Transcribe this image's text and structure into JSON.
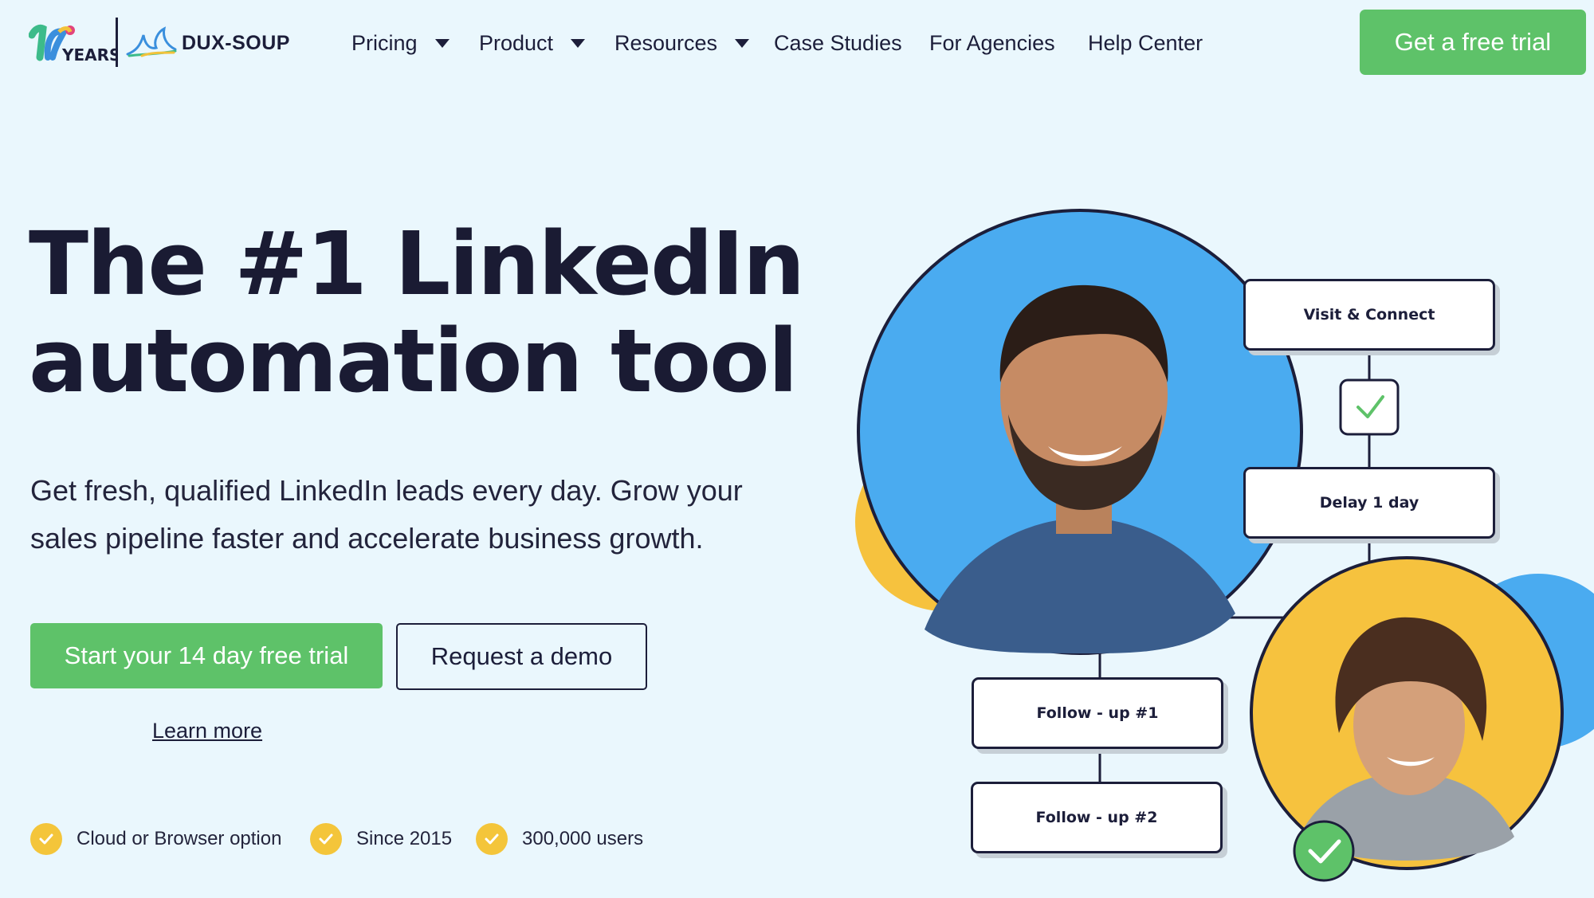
{
  "brand": {
    "anniversary_years_label": "YEARS",
    "name": "DUX-SOUP"
  },
  "nav": {
    "items": [
      {
        "label": "Pricing",
        "has_dropdown": true
      },
      {
        "label": "Product",
        "has_dropdown": true
      },
      {
        "label": "Resources",
        "has_dropdown": true
      },
      {
        "label": "Case Studies",
        "has_dropdown": false
      },
      {
        "label": "For Agencies",
        "has_dropdown": false
      },
      {
        "label": "Help Center",
        "has_dropdown": false
      }
    ],
    "cta_label": "Get a free trial"
  },
  "hero": {
    "headline_line1": "The #1 LinkedIn",
    "headline_line2": "automation tool",
    "subtext": "Get fresh, qualified LinkedIn leads every day. Grow your sales pipeline faster and accelerate business growth.",
    "primary_cta": "Start your 14 day free trial",
    "secondary_cta": "Request a demo",
    "learn_more": "Learn more",
    "features": [
      "Cloud or Browser option",
      "Since 2015",
      "300,000 users"
    ]
  },
  "flow": {
    "steps": [
      "Visit & Connect",
      "Delay 1 day",
      "Follow - up #1",
      "Follow - up #2"
    ]
  },
  "colors": {
    "background": "#eaf7fd",
    "accent_green": "#5ec269",
    "navy": "#1c1e3a",
    "check_yellow": "#f4c53a",
    "circle_blue": "#4aabf0",
    "circle_yellow": "#f6c23e"
  },
  "icons": [
    "caret-down-icon",
    "check-icon",
    "bird-logo-icon"
  ]
}
